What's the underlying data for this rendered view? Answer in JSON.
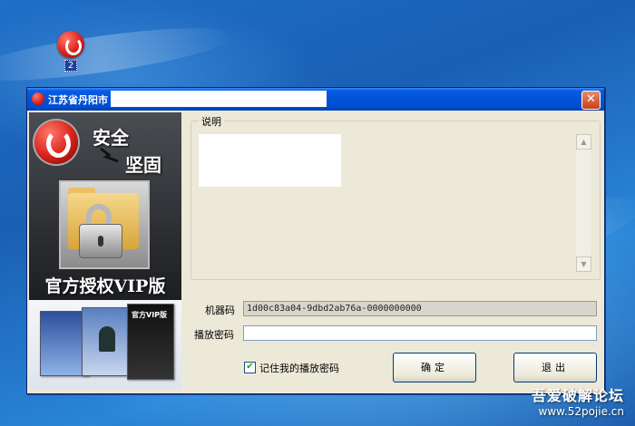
{
  "desktop": {
    "icon_label": "2"
  },
  "window": {
    "title": "江苏省丹阳市",
    "close_glyph": "✕"
  },
  "banner": {
    "slogan_line1": "安全",
    "slogan_line2": "坚固",
    "vip_title": "官方授权VIP版",
    "screenshot_caption": "官方VIP版"
  },
  "description": {
    "legend": "说明",
    "scroll_up_glyph": "▲",
    "scroll_down_glyph": "▼"
  },
  "form": {
    "machine_code_label": "机器码",
    "machine_code_value": "1d00c83a04-9dbd2ab76a-0000000000",
    "play_password_label": "播放密码",
    "play_password_value": "",
    "remember_label": "记住我的播放密码",
    "remember_checked": true,
    "check_glyph": "✔"
  },
  "buttons": {
    "ok_label": "确定",
    "exit_label": "退出"
  },
  "watermark": {
    "line1": "吾爱破解论坛",
    "line2": "www.52pojie.cn"
  },
  "colors": {
    "titlebar": "#0053d8",
    "window_bg": "#ece9d8",
    "desktop": "#1f6fc7",
    "close_button": "#c8401e"
  },
  "icons": {
    "app_logo": "red-circle-logo-icon",
    "lock_folder": "lock-folder-icon"
  }
}
